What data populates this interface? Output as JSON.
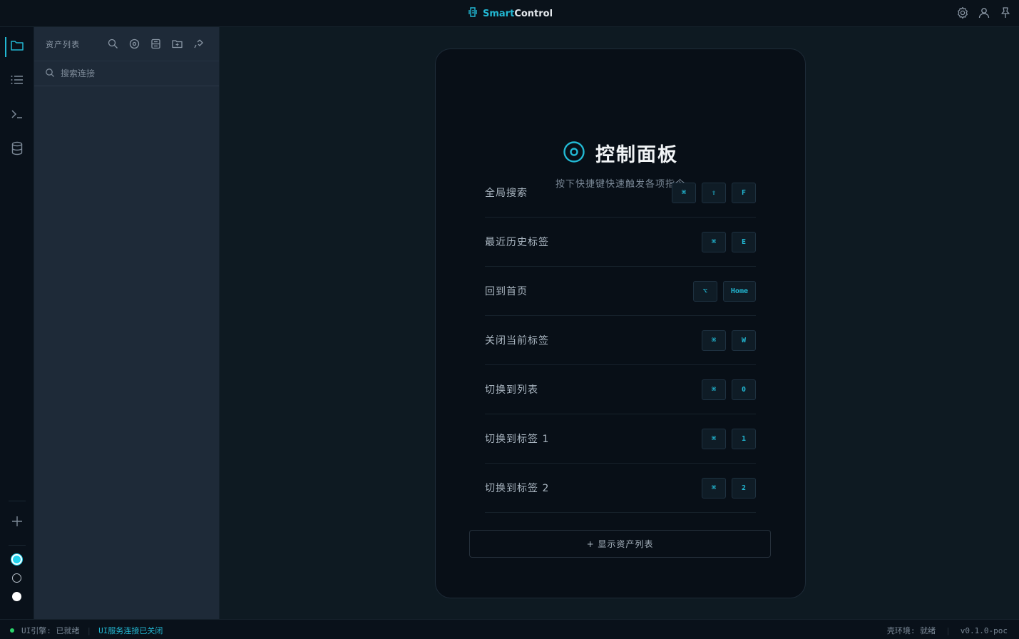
{
  "app": {
    "brand_accent": "Smart",
    "brand_rest": "Control",
    "accent_color": "#22b8d3"
  },
  "titlebar": {
    "icons": [
      "settings-icon",
      "user-icon",
      "pin-icon"
    ]
  },
  "activity_bar": {
    "items": [
      "folder-icon",
      "list-icon",
      "terminal-icon",
      "database-icon"
    ],
    "add_icon": "plus-icon",
    "theme_colors": [
      "#22d3ee",
      "#0b1219",
      "#ffffff"
    ]
  },
  "sidebar": {
    "title": "资产列表",
    "tools": [
      "search-icon",
      "target-icon",
      "server-icon",
      "folder-add-icon",
      "plugin-icon"
    ],
    "search_placeholder": "搜索连接"
  },
  "panel": {
    "title": "控制面板",
    "subtitle": "按下快捷键快速触发各项指令",
    "shortcuts": [
      {
        "label": "全局搜索",
        "keys": [
          "⌘",
          "⇧",
          "F"
        ]
      },
      {
        "label": "最近历史标签",
        "keys": [
          "⌘",
          "E"
        ]
      },
      {
        "label": "回到首页",
        "keys": [
          "⌥",
          "Home"
        ]
      },
      {
        "label": "关闭当前标签",
        "keys": [
          "⌘",
          "W"
        ]
      },
      {
        "label": "切换到列表",
        "keys": [
          "⌘",
          "0"
        ]
      },
      {
        "label": "切换到标签  1",
        "keys": [
          "⌘",
          "1"
        ]
      },
      {
        "label": "切换到标签  2",
        "keys": [
          "⌘",
          "2"
        ]
      }
    ],
    "show_assets_button": "+ 显示资产列表"
  },
  "statusbar": {
    "engine": "UI引擎: 已就绪",
    "service": "UI服务连接已关闭",
    "shell": "壳环境: 就绪",
    "version": "v0.1.0-poc"
  }
}
